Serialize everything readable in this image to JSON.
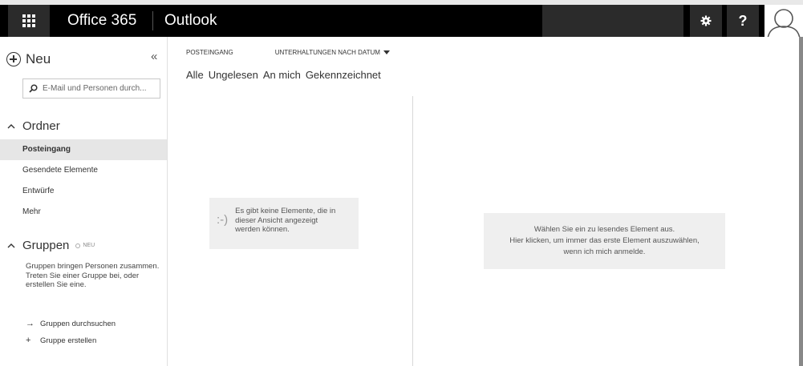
{
  "header": {
    "suite_name": "Office 365",
    "app_name": "Outlook",
    "icons": {
      "app_launcher": "waffle-grid-icon",
      "settings": "gear-icon",
      "help": "question-mark-icon",
      "avatar": "person-silhouette-icon"
    },
    "help_label": "?"
  },
  "nav": {
    "new_label": "Neu",
    "collapse_label": "«",
    "search_placeholder": "E-Mail und Personen durch...",
    "folders_section": "Ordner",
    "folders": [
      {
        "label": "Posteingang",
        "selected": true
      },
      {
        "label": "Gesendete Elemente",
        "selected": false
      },
      {
        "label": "Entwürfe",
        "selected": false
      },
      {
        "label": "Mehr",
        "selected": false
      }
    ],
    "groups_section": "Gruppen",
    "groups_badge": "NEU",
    "groups_description": "Gruppen bringen Personen zusammen. Treten Sie einer Gruppe bei, oder erstellen Sie eine.",
    "group_actions": [
      {
        "icon": "→",
        "label": "Gruppen durchsuchen"
      },
      {
        "icon": "+",
        "label": "Gruppe erstellen"
      }
    ]
  },
  "message_list": {
    "folder_title": "POSTEINGANG",
    "sort_label": "UNTERHALTUNGEN NACH DATUM",
    "filters": [
      "Alle",
      "Ungelesen",
      "An mich",
      "Gekennzeichnet"
    ],
    "empty_emoticon": ":-)",
    "empty_message": "Es gibt keine Elemente, die in dieser Ansicht angezeigt werden können."
  },
  "reading_pane": {
    "lines": [
      "Wählen Sie ein zu lesendes Element aus.",
      "Hier klicken, um immer das erste Element auszuwählen,",
      "wenn ich mich anmelde."
    ]
  },
  "colors": {
    "topbar": "#000000",
    "topbar_button": "#2b2b2b",
    "selected_folder": "#e6e6e6",
    "empty_box": "#efefef"
  }
}
